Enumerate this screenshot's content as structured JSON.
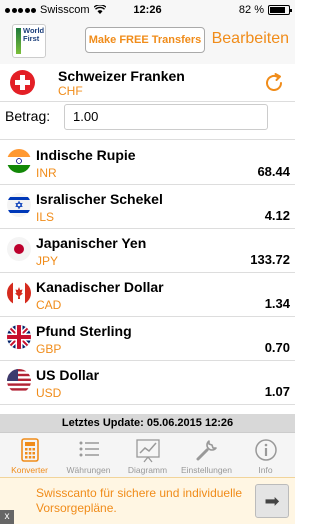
{
  "status_bar": {
    "carrier": "Swisscom",
    "time": "12:26",
    "battery": "82 %",
    "battery_level": 0.82
  },
  "nav": {
    "logo_text": "World First",
    "promo_button": "Make FREE Transfers",
    "edit_button": "Bearbeiten"
  },
  "base_currency": {
    "name": "Schweizer Franken",
    "code": "CHF"
  },
  "amount": {
    "label": "Betrag:",
    "value": "1.00"
  },
  "currencies": [
    {
      "name": "Indische Rupie",
      "code": "INR",
      "value": "68.44",
      "flag": "india-flag-icon"
    },
    {
      "name": "Isralischer Schekel",
      "code": "ILS",
      "value": "4.12",
      "flag": "israel-flag-icon"
    },
    {
      "name": "Japanischer Yen",
      "code": "JPY",
      "value": "133.72",
      "flag": "japan-flag-icon"
    },
    {
      "name": "Kanadischer Dollar",
      "code": "CAD",
      "value": "1.34",
      "flag": "canada-flag-icon"
    },
    {
      "name": "Pfund Sterling",
      "code": "GBP",
      "value": "0.70",
      "flag": "uk-flag-icon"
    },
    {
      "name": "US Dollar",
      "code": "USD",
      "value": "1.07",
      "flag": "us-flag-icon"
    }
  ],
  "update_text": "Letztes Update: 05.06.2015 12:26",
  "tabs": [
    {
      "label": "Konverter",
      "active": true
    },
    {
      "label": "Währungen",
      "active": false
    },
    {
      "label": "Diagramm",
      "active": false
    },
    {
      "label": "Einstellungen",
      "active": false
    },
    {
      "label": "Info",
      "active": false
    }
  ],
  "ad": {
    "text": "Swisscanto für sichere und individuelle Vorsorgepläne.",
    "close": "x"
  },
  "colors": {
    "accent": "#f08c1a",
    "swiss_red": "#e31f26"
  }
}
